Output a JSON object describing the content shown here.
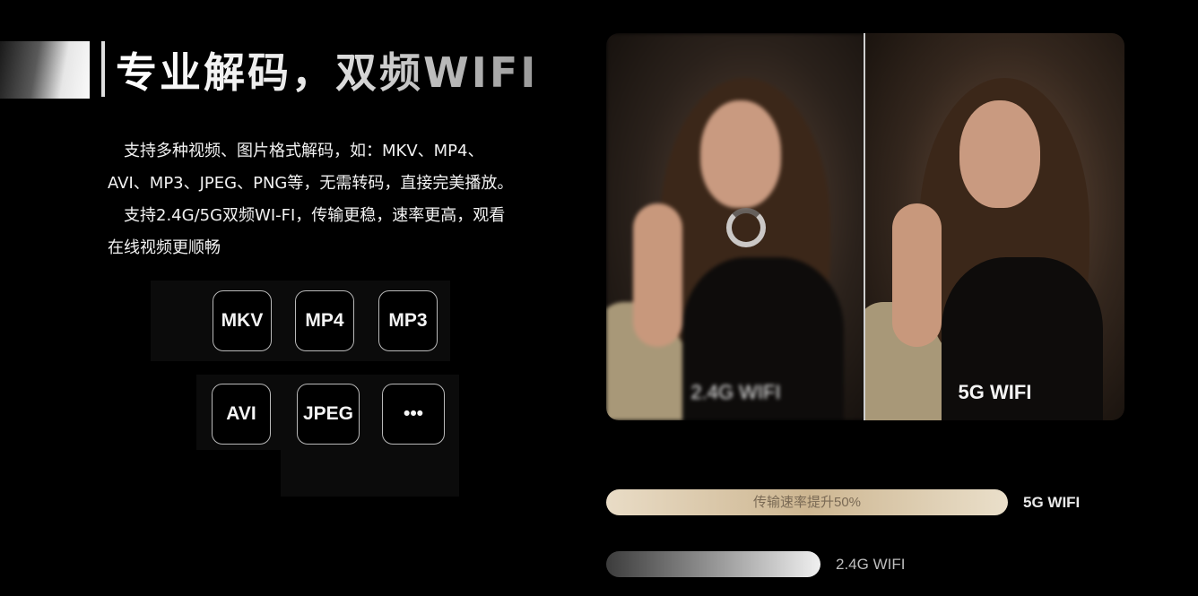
{
  "header": {
    "title": "专业解码，双频WIFI"
  },
  "description": {
    "lines": [
      "　支持多种视频、图片格式解码，如：MKV、MP4、",
      "AVI、MP3、JPEG、PNG等，无需转码，直接完美播放。",
      "　支持2.4G/5G双频WI-FI，传输更稳，速率更高，观看",
      "在线视频更顺畅"
    ]
  },
  "formats": [
    "MKV",
    "MP4",
    "MP3",
    "AVI",
    "JPEG",
    "•••"
  ],
  "comparison": {
    "left_label": "2.4G WIFI",
    "right_label": "5G WIFI"
  },
  "speed": {
    "bar_5g_text": "传输速率提升50%",
    "label_5g": "5G WIFI",
    "label_24g": "2.4G WIFI",
    "improvement_percent": 50
  },
  "colors": {
    "background": "#000000",
    "gold": "#cdb691"
  }
}
